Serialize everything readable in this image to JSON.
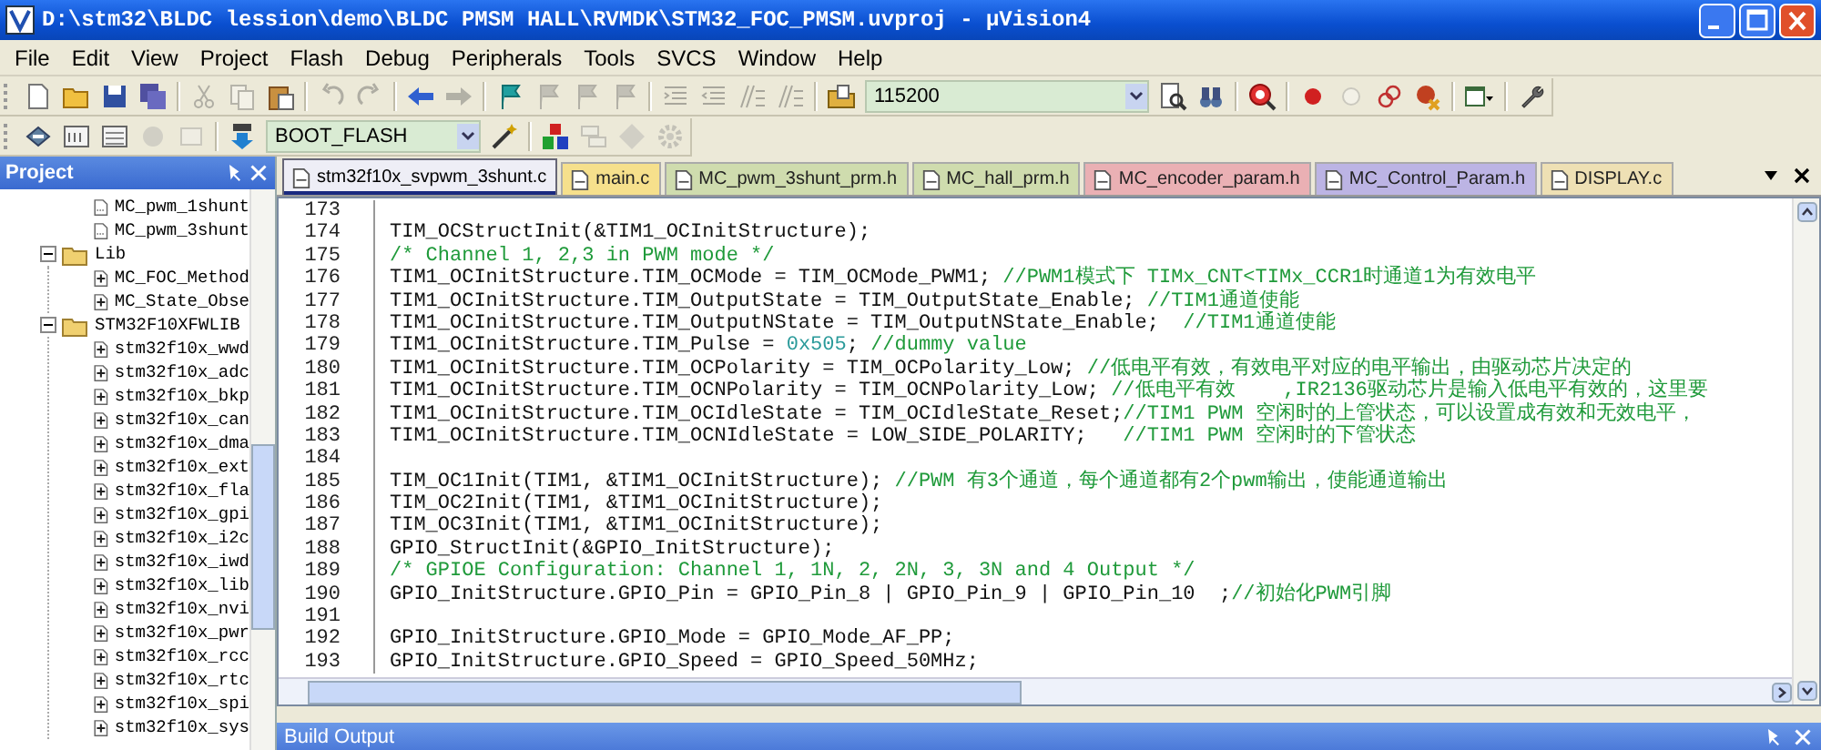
{
  "window": {
    "title": "D:\\stm32\\BLDC lession\\demo\\BLDC PMSM HALL\\RVMDK\\STM32_FOC_PMSM.uvproj - µVision4"
  },
  "menu": [
    "File",
    "Edit",
    "View",
    "Project",
    "Flash",
    "Debug",
    "Peripherals",
    "Tools",
    "SVCS",
    "Window",
    "Help"
  ],
  "toolbar_1": [
    {
      "kind": "new",
      "disabled": false
    },
    {
      "kind": "open",
      "disabled": false
    },
    {
      "kind": "save",
      "disabled": false
    },
    {
      "kind": "saveall",
      "disabled": false
    },
    {
      "kind": "sep"
    },
    {
      "kind": "cut",
      "disabled": true
    },
    {
      "kind": "copy",
      "disabled": true
    },
    {
      "kind": "paste",
      "disabled": false
    },
    {
      "kind": "sep"
    },
    {
      "kind": "undo",
      "disabled": true
    },
    {
      "kind": "redo",
      "disabled": true
    },
    {
      "kind": "sep"
    },
    {
      "kind": "back",
      "disabled": false
    },
    {
      "kind": "forward",
      "disabled": true
    },
    {
      "kind": "sep"
    },
    {
      "kind": "flag",
      "disabled": false
    },
    {
      "kind": "flag",
      "disabled": true
    },
    {
      "kind": "flag",
      "disabled": true
    },
    {
      "kind": "flag",
      "disabled": true
    },
    {
      "kind": "sep"
    },
    {
      "kind": "indent",
      "disabled": true
    },
    {
      "kind": "unindent",
      "disabled": true
    },
    {
      "kind": "comment",
      "disabled": true
    },
    {
      "kind": "comment",
      "disabled": true
    },
    {
      "kind": "sep"
    },
    {
      "kind": "findfiles",
      "disabled": false
    },
    {
      "kind": "combo",
      "value": "115200"
    },
    {
      "kind": "find",
      "disabled": false
    },
    {
      "kind": "binoculars",
      "disabled": false
    },
    {
      "kind": "sep"
    },
    {
      "kind": "debug",
      "disabled": false
    },
    {
      "kind": "sep"
    },
    {
      "kind": "breakpoint",
      "disabled": false
    },
    {
      "kind": "hollow",
      "disabled": true
    },
    {
      "kind": "chain",
      "disabled": false
    },
    {
      "kind": "bpkill",
      "disabled": false
    },
    {
      "kind": "sep"
    },
    {
      "kind": "window",
      "disabled": false
    },
    {
      "kind": "sep"
    },
    {
      "kind": "wrench",
      "disabled": false
    }
  ],
  "toolbar_2": [
    {
      "kind": "translate",
      "disabled": false
    },
    {
      "kind": "build",
      "disabled": false
    },
    {
      "kind": "rebuild",
      "disabled": false
    },
    {
      "kind": "batch",
      "disabled": true
    },
    {
      "kind": "stop",
      "disabled": true
    },
    {
      "kind": "sep"
    },
    {
      "kind": "load",
      "disabled": false
    },
    {
      "kind": "combo",
      "value": "BOOT_FLASH"
    },
    {
      "kind": "wand",
      "disabled": false
    },
    {
      "kind": "sep"
    },
    {
      "kind": "blocks",
      "disabled": false
    },
    {
      "kind": "stack",
      "disabled": true
    },
    {
      "kind": "diamond",
      "disabled": true
    },
    {
      "kind": "gear",
      "disabled": true
    }
  ],
  "project": {
    "title": "Project",
    "tree": [
      {
        "label": "MC_pwm_1shunt",
        "kind": "doc"
      },
      {
        "label": "MC_pwm_3shunt",
        "kind": "doc"
      },
      {
        "label": "Lib",
        "kind": "group",
        "expanded": true,
        "children": [
          {
            "label": "MC_FOC_Method",
            "kind": "source"
          },
          {
            "label": "MC_State_Obse",
            "kind": "source"
          }
        ]
      },
      {
        "label": "STM32F10XFWLIB",
        "kind": "group",
        "expanded": true,
        "children": [
          {
            "label": "stm32f10x_wwd",
            "kind": "source"
          },
          {
            "label": "stm32f10x_adc",
            "kind": "source"
          },
          {
            "label": "stm32f10x_bkp",
            "kind": "source"
          },
          {
            "label": "stm32f10x_can",
            "kind": "source"
          },
          {
            "label": "stm32f10x_dma",
            "kind": "source"
          },
          {
            "label": "stm32f10x_ext",
            "kind": "source"
          },
          {
            "label": "stm32f10x_fla",
            "kind": "source"
          },
          {
            "label": "stm32f10x_gpi",
            "kind": "source"
          },
          {
            "label": "stm32f10x_i2c",
            "kind": "source"
          },
          {
            "label": "stm32f10x_iwd",
            "kind": "source"
          },
          {
            "label": "stm32f10x_lib",
            "kind": "source"
          },
          {
            "label": "stm32f10x_nvi",
            "kind": "source"
          },
          {
            "label": "stm32f10x_pwr",
            "kind": "source"
          },
          {
            "label": "stm32f10x_rcc",
            "kind": "source"
          },
          {
            "label": "stm32f10x_rtc",
            "kind": "source"
          },
          {
            "label": "stm32f10x_spi",
            "kind": "source"
          },
          {
            "label": "stm32f10x_sys",
            "kind": "source"
          }
        ]
      }
    ]
  },
  "tabs": [
    {
      "label": "stm32f10x_svpwm_3shunt.c",
      "color": "#eeeef6",
      "selected": true
    },
    {
      "label": "main.c",
      "color": "#f6e08c",
      "selected": false
    },
    {
      "label": "MC_pwm_3shunt_prm.h",
      "color": "#cfdcae",
      "selected": false
    },
    {
      "label": "MC_hall_prm.h",
      "color": "#cfdcae",
      "selected": false
    },
    {
      "label": "MC_encoder_param.h",
      "color": "#eab0b4",
      "selected": false
    },
    {
      "label": "MC_Control_Param.h",
      "color": "#bcb4e4",
      "selected": false
    },
    {
      "label": "DISPLAY.c",
      "color": "#eee0b4",
      "selected": false
    }
  ],
  "editor": {
    "lines": [
      {
        "number": "173"
      },
      {
        "number": "174",
        "segments": [
          {
            "kind": "code",
            "text": "TIM_OCStructInit(&TIM1_OCInitStructure);"
          }
        ]
      },
      {
        "number": "175",
        "segments": [
          {
            "kind": "comment",
            "text": "/* Channel 1, 2,3 in PWM mode */"
          }
        ]
      },
      {
        "number": "176",
        "segments": [
          {
            "kind": "code",
            "text": "TIM1_OCInitStructure.TIM_OCMode = TIM_OCMode_PWM1; "
          },
          {
            "kind": "comment",
            "text": "//PWM1模式下 TIMx_CNT<TIMx_CCR1时通道1为有效电平"
          }
        ]
      },
      {
        "number": "177",
        "segments": [
          {
            "kind": "code",
            "text": "TIM1_OCInitStructure.TIM_OutputState = TIM_OutputState_Enable; "
          },
          {
            "kind": "comment",
            "text": "//TIM1通道使能"
          }
        ]
      },
      {
        "number": "178",
        "segments": [
          {
            "kind": "code",
            "text": "TIM1_OCInitStructure.TIM_OutputNState = TIM_OutputNState_Enable;  "
          },
          {
            "kind": "comment",
            "text": "//TIM1通道使能"
          }
        ]
      },
      {
        "number": "179",
        "segments": [
          {
            "kind": "code",
            "text": "TIM1_OCInitStructure.TIM_Pulse = "
          },
          {
            "kind": "number",
            "text": "0x505"
          },
          {
            "kind": "code",
            "text": "; "
          },
          {
            "kind": "comment",
            "text": "//dummy value"
          }
        ]
      },
      {
        "number": "180",
        "segments": [
          {
            "kind": "code",
            "text": "TIM1_OCInitStructure.TIM_OCPolarity = TIM_OCPolarity_Low; "
          },
          {
            "kind": "comment",
            "text": "//低电平有效，有效电平对应的电平输出，由驱动芯片决定的"
          }
        ]
      },
      {
        "number": "181",
        "segments": [
          {
            "kind": "code",
            "text": "TIM1_OCInitStructure.TIM_OCNPolarity = TIM_OCNPolarity_Low; "
          },
          {
            "kind": "comment",
            "text": "//低电平有效    ,IR2136驱动芯片是输入低电平有效的，这里要"
          }
        ]
      },
      {
        "number": "182",
        "segments": [
          {
            "kind": "code",
            "text": "TIM1_OCInitStructure.TIM_OCIdleState = TIM_OCIdleState_Reset;"
          },
          {
            "kind": "comment",
            "text": "//TIM1 PWM 空闲时的上管状态，可以设置成有效和无效电平，"
          }
        ]
      },
      {
        "number": "183",
        "segments": [
          {
            "kind": "code",
            "text": "TIM1_OCInitStructure.TIM_OCNIdleState = LOW_SIDE_POLARITY;   "
          },
          {
            "kind": "comment",
            "text": "//TIM1 PWM 空闲时的下管状态"
          }
        ]
      },
      {
        "number": "184"
      },
      {
        "number": "185",
        "segments": [
          {
            "kind": "code",
            "text": "TIM_OC1Init(TIM1, &TIM1_OCInitStructure); "
          },
          {
            "kind": "comment",
            "text": "//PWM 有3个通道，每个通道都有2个pwm输出，使能通道输出"
          }
        ]
      },
      {
        "number": "186",
        "segments": [
          {
            "kind": "code",
            "text": "TIM_OC2Init(TIM1, &TIM1_OCInitStructure);"
          }
        ]
      },
      {
        "number": "187",
        "segments": [
          {
            "kind": "code",
            "text": "TIM_OC3Init(TIM1, &TIM1_OCInitStructure);"
          }
        ]
      },
      {
        "number": "188",
        "segments": [
          {
            "kind": "code",
            "text": "GPIO_StructInit(&GPIO_InitStructure);"
          }
        ]
      },
      {
        "number": "189",
        "segments": [
          {
            "kind": "comment",
            "text": "/* GPIOE Configuration: Channel 1, 1N, 2, 2N, 3, 3N and 4 Output */"
          }
        ]
      },
      {
        "number": "190",
        "segments": [
          {
            "kind": "code",
            "text": "GPIO_InitStructure.GPIO_Pin = GPIO_Pin_8 | GPIO_Pin_9 | GPIO_Pin_10  ;"
          },
          {
            "kind": "comment",
            "text": "//初始化PWM引脚"
          }
        ]
      },
      {
        "number": "191"
      },
      {
        "number": "192",
        "segments": [
          {
            "kind": "code",
            "text": "GPIO_InitStructure.GPIO_Mode = GPIO_Mode_AF_PP;"
          }
        ]
      },
      {
        "number": "193",
        "segments": [
          {
            "kind": "code",
            "text": "GPIO_InitStructure.GPIO_Speed = GPIO_Speed_50MHz;"
          }
        ]
      }
    ]
  },
  "build_output": {
    "title": "Build Output"
  }
}
